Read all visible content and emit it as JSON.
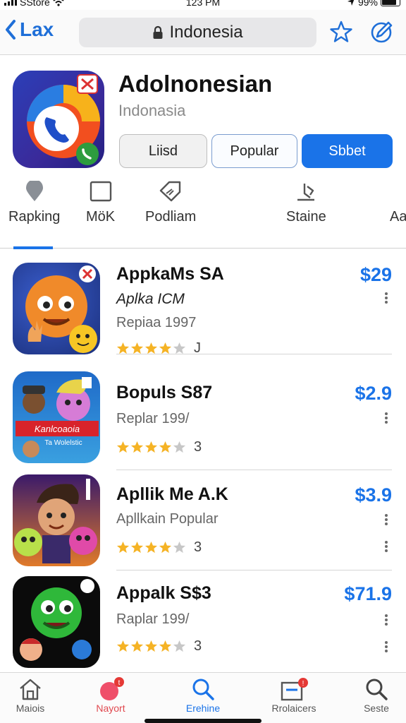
{
  "status_bar": {
    "carrier": "SStore",
    "time": "123 PM",
    "battery": "99%"
  },
  "nav": {
    "back_label": "Lax",
    "url_text": "Indonesia"
  },
  "header": {
    "title": "Adolnonesian",
    "subtitle": "Indonasia",
    "buttons": [
      "Liisd",
      "Popular",
      "Sbbet"
    ]
  },
  "categories": [
    {
      "label": "Rapking",
      "icon": "pin-icon"
    },
    {
      "label": "MöK",
      "icon": "square-icon"
    },
    {
      "label": "Podliam",
      "icon": "tag-icon"
    },
    {
      "label": "Staine",
      "icon": "edit-icon"
    },
    {
      "label": "Aa",
      "icon": ""
    }
  ],
  "apps": [
    {
      "name": "AppkaMs SA",
      "line2": "Aplka ICM",
      "line3": "Repiaa 1997",
      "price": "$29",
      "rating": 4,
      "count": "J"
    },
    {
      "name": "Bopuls S87",
      "line2": "",
      "line3": "Replar 199/",
      "price": "$2.9",
      "rating": 4,
      "count": "3"
    },
    {
      "name": "Apllik Me A.K",
      "line2": "",
      "line3": "Apllkain Popular",
      "price": "$3.9",
      "rating": 4,
      "count": "3"
    },
    {
      "name": "Appalk S$3",
      "line2": "",
      "line3": "Raplar 199/",
      "price": "$71.9",
      "rating": 4,
      "count": "3"
    }
  ],
  "tabs": [
    {
      "label": "Maiois",
      "icon": "home-icon",
      "badge": ""
    },
    {
      "label": "Nayort",
      "icon": "bubble-icon",
      "badge": "t"
    },
    {
      "label": "Erehine",
      "icon": "search-icon",
      "badge": ""
    },
    {
      "label": "Rrolaicers",
      "icon": "inbox-icon",
      "badge": "!"
    },
    {
      "label": "Seste",
      "icon": "search-icon",
      "badge": ""
    }
  ],
  "colors": {
    "accent": "#1a73e8",
    "star": "#f5b325",
    "badge": "#e53935"
  }
}
